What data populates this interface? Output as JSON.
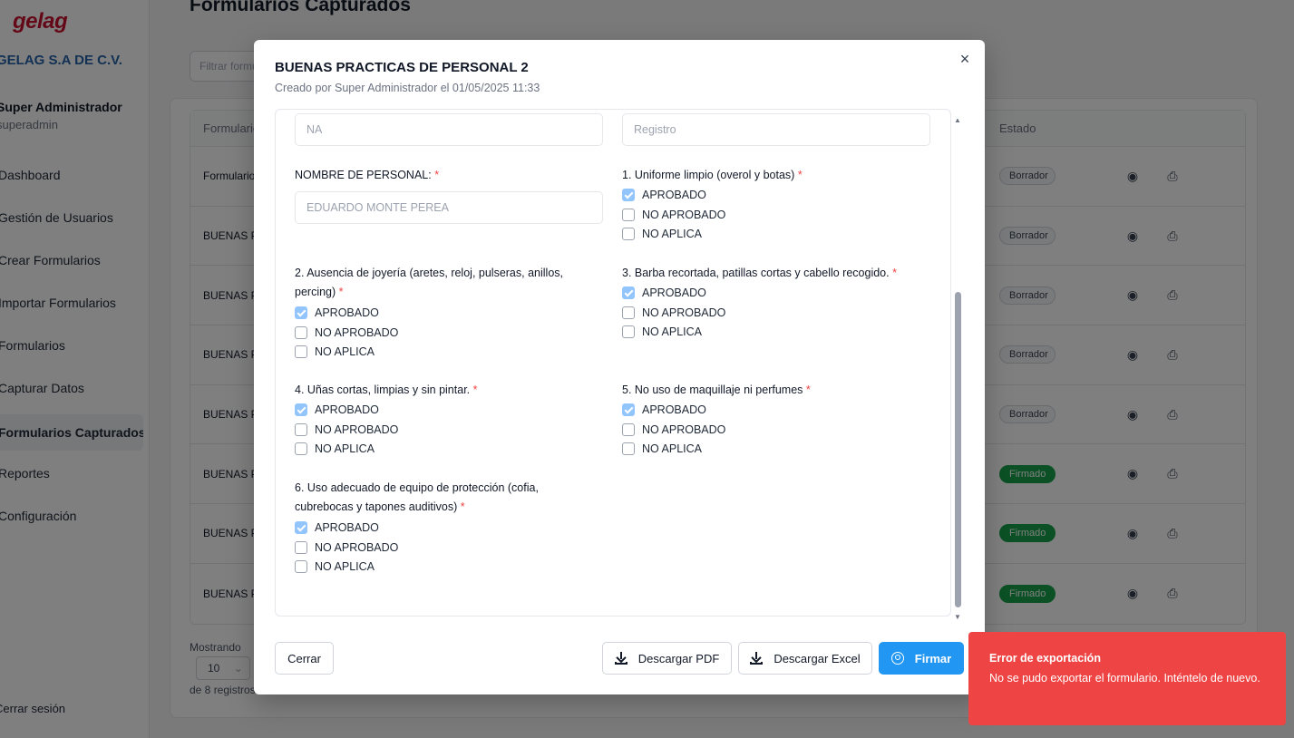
{
  "app": {
    "logo": "gelag",
    "company": "GELAG S.A DE C.V.",
    "user_name": "Super Administrador",
    "user_role": "superadmin",
    "nav": [
      {
        "label": "Dashboard",
        "active": false
      },
      {
        "label": "Gestión de Usuarios",
        "active": false
      },
      {
        "label": "Crear Formularios",
        "active": false
      },
      {
        "label": "Importar Formularios",
        "active": false
      },
      {
        "label": "Formularios",
        "active": false
      },
      {
        "label": "Capturar Datos",
        "active": false
      },
      {
        "label": "Formularios Capturados",
        "active": true
      },
      {
        "label": "Reportes",
        "active": false
      },
      {
        "label": "Configuración",
        "active": false
      }
    ],
    "logout": "Cerrar sesión"
  },
  "page": {
    "title": "Formularios Capturados",
    "filter_placeholder": "Filtrar formularios...",
    "table_headers": {
      "form": "Formulario",
      "status": "Estado"
    },
    "rows": [
      {
        "form": "Formulario",
        "status": "Borrador",
        "signed": false
      },
      {
        "form": "BUENAS PRACTICAS DE PERSONAL",
        "status": "Borrador",
        "signed": false
      },
      {
        "form": "BUENAS PRACTICAS DE PERSONAL",
        "status": "Borrador",
        "signed": false
      },
      {
        "form": "BUENAS PRACTICAS DE PERSONAL",
        "status": "Borrador",
        "signed": false
      },
      {
        "form": "BUENAS PRACTICAS DE PERSONAL",
        "status": "Borrador",
        "signed": false
      },
      {
        "form": "BUENAS PRACTICAS DE PERSONAL",
        "status": "Firmado",
        "signed": true
      },
      {
        "form": "BUENAS PRACTICAS DE PERSONAL",
        "status": "Firmado",
        "signed": true
      },
      {
        "form": "BUENAS PRACTICAS DE PERSONAL",
        "status": "Firmado",
        "signed": true
      }
    ],
    "showing": "Mostrando",
    "page_size": "10",
    "of_records": "de 8 registros"
  },
  "modal": {
    "title": "BUENAS PRACTICAS DE PERSONAL 2",
    "subtitle": "Creado por Super Administrador el 01/05/2025 11:33",
    "top_left_value": "NA",
    "top_right_value": "Registro",
    "name_label": "NOMBRE DE PERSONAL:",
    "name_value": "EDUARDO MONTE PEREA",
    "questions": [
      {
        "label": "1. Uniforme limpio (overol y botas)"
      },
      {
        "label": "2. Ausencia de joyería (aretes, reloj, pulseras, anillos, percing)"
      },
      {
        "label": "3. Barba recortada, patillas cortas y cabello recogido."
      },
      {
        "label": "4. Uñas cortas, limpias y sin pintar."
      },
      {
        "label": "5. No uso de maquillaje ni perfumes"
      },
      {
        "label": "6. Uso adecuado de equipo de protección (cofia, cubrebocas y tapones auditivos)"
      }
    ],
    "options": [
      "APROBADO",
      "NO APROBADO",
      "NO APLICA"
    ],
    "required_mark": "*",
    "buttons": {
      "close": "Cerrar",
      "pdf": "Descargar PDF",
      "excel": "Descargar Excel",
      "sign": "Firmar"
    }
  },
  "toast": {
    "title": "Error de exportación",
    "message": "No se pudo exportar el formulario. Inténtelo de nuevo."
  },
  "colors": {
    "primary": "#2196f3",
    "error": "#ef4444",
    "checked": "#93c5fd",
    "signed_badge": "#16a34a"
  }
}
